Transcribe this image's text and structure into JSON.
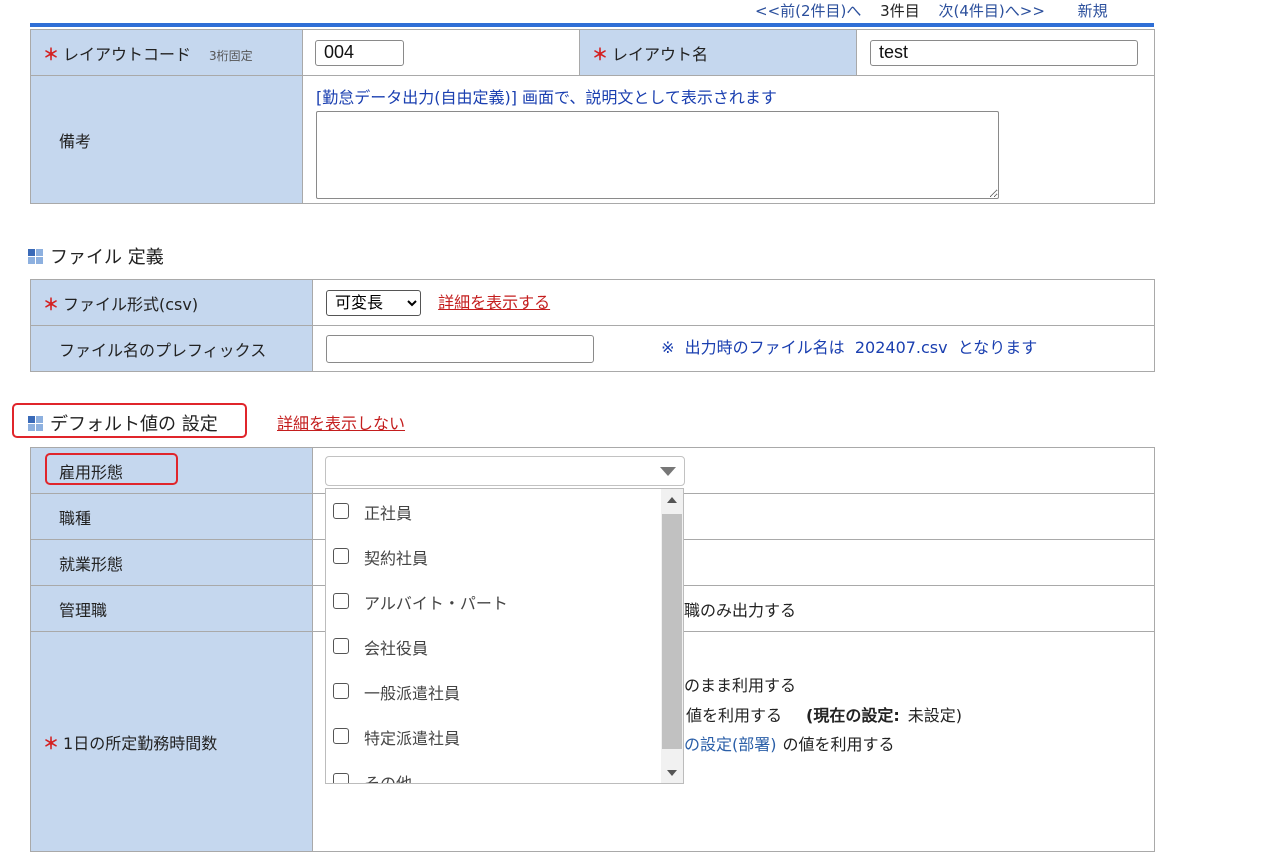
{
  "nav": {
    "prev": "<<前(2件目)へ",
    "current": "3件目",
    "next": "次(4件目)へ>>",
    "new": "新規"
  },
  "layout_section": {
    "layout_code_label": "レイアウトコード",
    "layout_code_note": "3桁固定",
    "layout_code_value": "004",
    "layout_name_label": "レイアウト名",
    "layout_name_value": "test",
    "remarks_label": "備考",
    "remarks_note": "[勤怠データ出力(自由定義)] 画面で、説明文として表示されます",
    "required_mark": "＊"
  },
  "file_section": {
    "title": "ファイル 定義",
    "format_label": "ファイル形式(csv)",
    "format_selected": "可変長",
    "show_details_link": "詳細を表示する",
    "prefix_label": "ファイル名のプレフィックス",
    "prefix_value": "",
    "filename_note": "※  出力時のファイル名は  202407.csv  となります"
  },
  "default_section": {
    "title": "デフォルト値の 設定",
    "hide_details_link": "詳細を表示しない",
    "rows": {
      "employment_type": "雇用形態",
      "job_type": "職種",
      "work_style": "就業形態",
      "manager": "管理職",
      "daily_hours": "1日の所定勤務時間数"
    },
    "manager_text_partial": "職のみ出力する",
    "daily_hours_text1": "のまま利用する",
    "daily_hours_text2_a": "値を利用する",
    "daily_hours_text2_b": "(現在の設定:",
    "daily_hours_text2_c": "未設定)",
    "daily_hours_text3_a": "の設定(部署)",
    "daily_hours_text3_b": "の値を利用する"
  },
  "employment_dropdown": {
    "selected": "",
    "options": [
      "正社員",
      "契約社員",
      "アルバイト・パート",
      "会社役員",
      "一般派遣社員",
      "特定派遣社員",
      "その他"
    ]
  },
  "colors": {
    "label_bg": "#c5d7ee",
    "accent_blue": "#2f6fd6",
    "required_red": "#d42020",
    "link_red": "#c41e1e",
    "highlight_red": "#e0252b"
  }
}
